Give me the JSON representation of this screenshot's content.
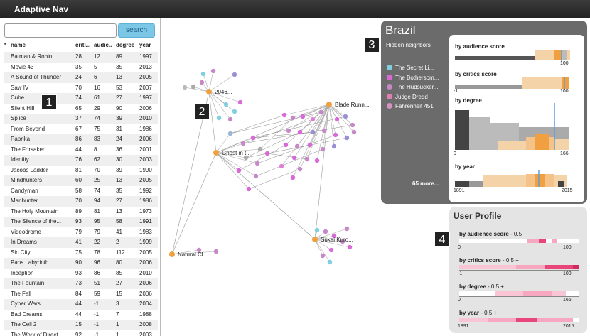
{
  "app": {
    "title": "Adaptive Nav"
  },
  "search": {
    "placeholder": "",
    "button_label": "search"
  },
  "table": {
    "sort_marker": "*",
    "columns": [
      "name",
      "criti...",
      "audie...",
      "degree",
      "year"
    ],
    "rows": [
      [
        "Batman & Robin",
        "28",
        "12",
        "89",
        "1997"
      ],
      [
        "Movie 43",
        "35",
        "5",
        "35",
        "2013"
      ],
      [
        "A Sound of Thunder",
        "24",
        "6",
        "13",
        "2005"
      ],
      [
        "Saw IV",
        "70",
        "16",
        "53",
        "2007"
      ],
      [
        "Cube",
        "74",
        "61",
        "27",
        "1997"
      ],
      [
        "Silent Hill",
        "65",
        "29",
        "90",
        "2006"
      ],
      [
        "Splice",
        "37",
        "74",
        "39",
        "2010"
      ],
      [
        "From Beyond",
        "67",
        "75",
        "31",
        "1986"
      ],
      [
        "Paprika",
        "86",
        "83",
        "24",
        "2006"
      ],
      [
        "The Forsaken",
        "44",
        "8",
        "36",
        "2001"
      ],
      [
        "Identity",
        "76",
        "62",
        "30",
        "2003"
      ],
      [
        "Jacobs Ladder",
        "81",
        "70",
        "39",
        "1990"
      ],
      [
        "Mindhunters",
        "60",
        "25",
        "13",
        "2005"
      ],
      [
        "Candyman",
        "58",
        "74",
        "35",
        "1992"
      ],
      [
        "Manhunter",
        "70",
        "94",
        "27",
        "1986"
      ],
      [
        "The Holy Mountain",
        "89",
        "81",
        "13",
        "1973"
      ],
      [
        "The Silence of the...",
        "93",
        "95",
        "58",
        "1991"
      ],
      [
        "Videodrome",
        "79",
        "79",
        "41",
        "1983"
      ],
      [
        "In Dreams",
        "41",
        "22",
        "2",
        "1999"
      ],
      [
        "Sin City",
        "75",
        "78",
        "112",
        "2005"
      ],
      [
        "Pans Labyrinth",
        "90",
        "96",
        "80",
        "2006"
      ],
      [
        "Inception",
        "93",
        "86",
        "85",
        "2010"
      ],
      [
        "The Fountain",
        "73",
        "51",
        "27",
        "2006"
      ],
      [
        "The Fall",
        "84",
        "59",
        "15",
        "2006"
      ],
      [
        "Cyber Wars",
        "44",
        "-1",
        "3",
        "2004"
      ],
      [
        "Bad Dreams",
        "44",
        "-1",
        "7",
        "1988"
      ],
      [
        "The Cell 2",
        "15",
        "-1",
        "1",
        "2008"
      ],
      [
        "The Work of Direct...",
        "92",
        "-1",
        "1",
        "2003"
      ]
    ]
  },
  "badges": [
    "1",
    "2",
    "3",
    "4"
  ],
  "graph": {
    "labels": [
      "2046...",
      "Blade Runn...",
      "Ghost in t...",
      "Sukai Kuro...",
      "Natural Cl..."
    ]
  },
  "country": {
    "title": "Brazil",
    "hidden_label": "Hidden neighbors",
    "neighbors": [
      {
        "label": "The Secret Li...",
        "color": "#7fcfdf"
      },
      {
        "label": "The Bothersom...",
        "color": "#d86ad8"
      },
      {
        "label": "The Hudsucker...",
        "color": "#c788c7"
      },
      {
        "label": "Judge Dredd",
        "color": "#e07fb0"
      },
      {
        "label": "Fahrenheit 451",
        "color": "#d890c0"
      }
    ],
    "more": "65 more...",
    "hist": {
      "audience": {
        "title": "by audience score",
        "min": "",
        "max": "100"
      },
      "critics": {
        "title": "by critics score",
        "min": "-1",
        "max": "100"
      },
      "degree": {
        "title": "by degree",
        "min": "0",
        "max": "166"
      },
      "year": {
        "title": "by year",
        "min": "1891",
        "max": "2015"
      }
    }
  },
  "profile": {
    "title": "User Profile",
    "suffix": " - 0.5 +",
    "items": [
      {
        "name": "by audience score",
        "min": "0",
        "max": "100"
      },
      {
        "name": "by critics score",
        "min": "-1",
        "max": "100"
      },
      {
        "name": "by degree",
        "min": "0",
        "max": "166"
      },
      {
        "name": "by year",
        "min": "1891",
        "max": "2015"
      }
    ]
  },
  "colors": {
    "accent": "#7cc6e6",
    "node_orange": "#f0a040",
    "node_pink": "#e07fd8",
    "node_cyan": "#7fcfdf",
    "panel_gray": "#6b6b6b",
    "profile_pink": "#e8457a"
  }
}
